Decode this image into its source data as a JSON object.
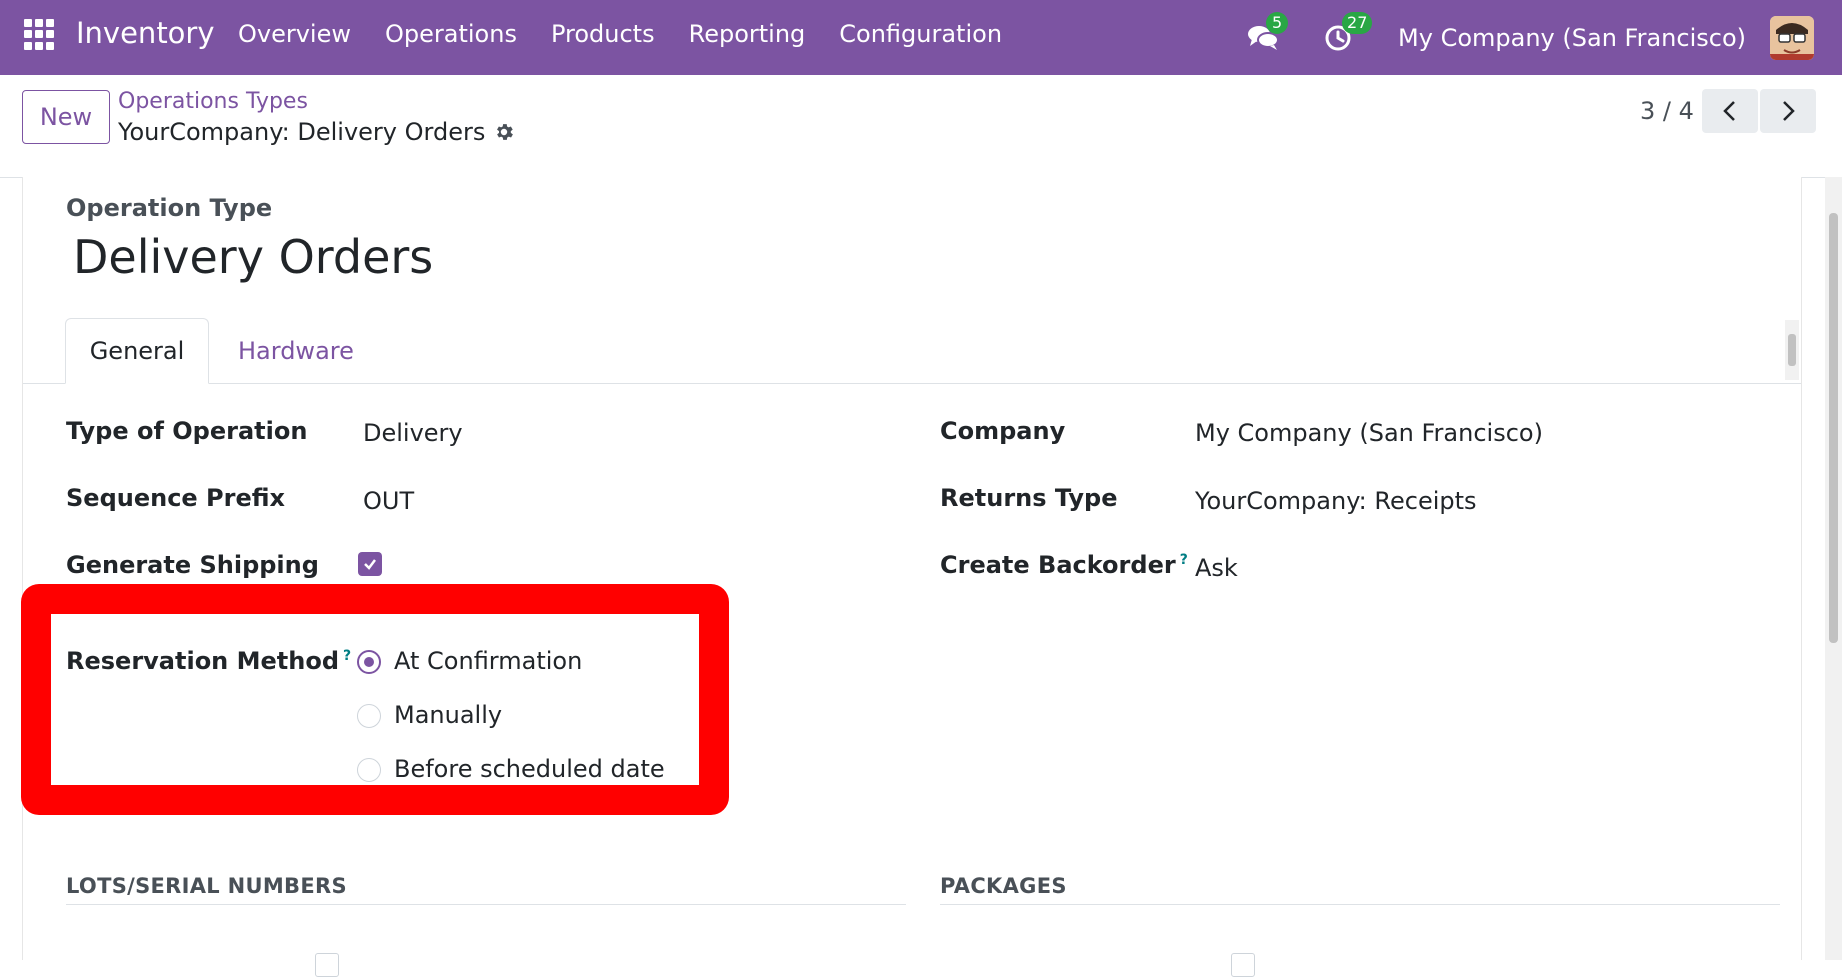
{
  "navbar": {
    "app_name": "Inventory",
    "menu": [
      "Overview",
      "Operations",
      "Products",
      "Reporting",
      "Configuration"
    ],
    "messages_count": "5",
    "activities_count": "27",
    "company": "My Company (San Francisco)",
    "accent_color": "#7c54a2",
    "badge_color": "#29a745"
  },
  "control": {
    "new_label": "New",
    "breadcrumb_parent": "Operations Types",
    "breadcrumb_current": "YourCompany: Delivery Orders",
    "pager": "3 / 4"
  },
  "form": {
    "kicker": "Operation Type",
    "title": "Delivery Orders",
    "tabs": [
      "General",
      "Hardware"
    ],
    "left": {
      "type_of_operation_label": "Type of Operation",
      "type_of_operation_value": "Delivery",
      "sequence_prefix_label": "Sequence Prefix",
      "sequence_prefix_value": "OUT",
      "generate_shipping_label": "Generate Shipping",
      "generate_shipping_checked": true,
      "reservation_method_label": "Reservation Method",
      "reservation_options": [
        "At Confirmation",
        "Manually",
        "Before scheduled date"
      ],
      "reservation_selected": "At Confirmation"
    },
    "right": {
      "company_label": "Company",
      "company_value": "My Company (San Francisco)",
      "returns_type_label": "Returns Type",
      "returns_type_value": "YourCompany: Receipts",
      "create_backorder_label": "Create Backorder",
      "create_backorder_value": "Ask"
    },
    "help_mark": "?",
    "sections": {
      "lots": "LOTS/SERIAL NUMBERS",
      "packages": "PACKAGES"
    },
    "highlight_color": "#ff0000"
  }
}
